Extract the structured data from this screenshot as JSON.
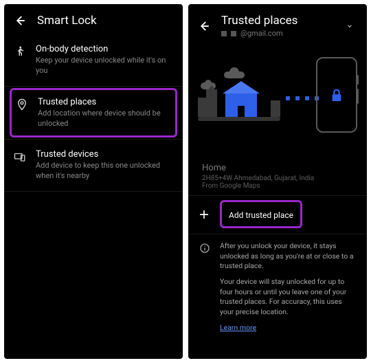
{
  "left": {
    "header_title": "Smart Lock",
    "options": {
      "onbody": {
        "title": "On-body detection",
        "desc": "Keep your device unlocked while it's on you"
      },
      "trusted_places": {
        "title": "Trusted places",
        "desc": "Add location where device should be unlocked"
      },
      "trusted_devices": {
        "title": "Trusted devices",
        "desc": "Add device to keep this one unlocked when it's nearby"
      }
    }
  },
  "right": {
    "header_title": "Trusted places",
    "header_account": "@gmail.com",
    "location": {
      "name": "Home",
      "address": "2H85+4W Ahmedabad, Gujarat, India",
      "source": "From Google Maps"
    },
    "add_label": "Add trusted place",
    "info": {
      "p1": "After you unlock your device, it stays unlocked as long as you're at or close to a trusted place.",
      "p2": "Your device will stay unlocked for up to four hours or until you leave one of your trusted places. For accuracy, this uses your precise location.",
      "learn": "Learn more"
    }
  }
}
